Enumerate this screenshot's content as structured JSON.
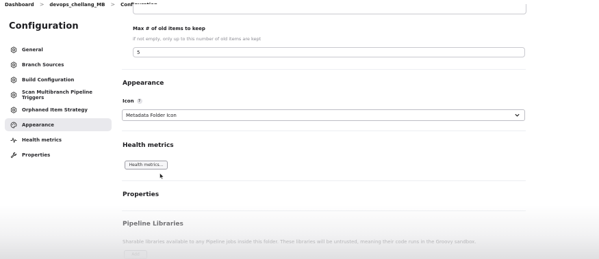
{
  "breadcrumb": {
    "items": [
      "Dashboard",
      "devops_chellang_MB",
      "Configuration"
    ],
    "separator": ">"
  },
  "page": {
    "title": "Configuration"
  },
  "sidebar": {
    "items": [
      {
        "label": "General",
        "icon": "gear-icon"
      },
      {
        "label": "Branch Sources",
        "icon": "gear-icon"
      },
      {
        "label": "Build Configuration",
        "icon": "gear-icon"
      },
      {
        "label": "Scan Multibranch Pipeline Triggers",
        "icon": "gear-icon"
      },
      {
        "label": "Orphaned Item Strategy",
        "icon": "gear-icon"
      },
      {
        "label": "Appearance",
        "icon": "palette-icon",
        "active": true
      },
      {
        "label": "Health metrics",
        "icon": "pulse-icon"
      },
      {
        "label": "Properties",
        "icon": "wrench-icon"
      }
    ]
  },
  "orphaned": {
    "max_items_label": "Max # of old items to keep",
    "max_items_help": "if not empty, only up to this number of old items are kept",
    "max_items_value": "5"
  },
  "appearance": {
    "title": "Appearance",
    "icon_label": "Icon",
    "help_glyph": "?",
    "icon_select_value": "Metadata Folder Icon"
  },
  "health_metrics": {
    "title": "Health metrics",
    "button_label": "Health metrics..."
  },
  "properties": {
    "title": "Properties"
  },
  "pipeline_libraries": {
    "title": "Pipeline Libraries",
    "description": "Sharable libraries available to any Pipeline jobs inside this folder. These libraries will be untrusted, meaning their code runs in the Groovy sandbox.",
    "add_button": "Add"
  },
  "colors": {
    "active_nav_bg": "#e9e9ed",
    "text": "#1b1b1f",
    "help_text": "#8a8a92",
    "border": "#c9c9cf"
  }
}
